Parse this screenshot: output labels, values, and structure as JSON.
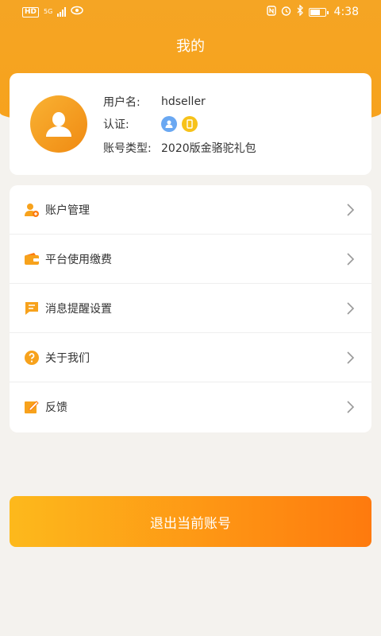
{
  "status_bar": {
    "left_chip": "HD",
    "network": "5G",
    "time": "4:38"
  },
  "page": {
    "title": "我的"
  },
  "profile": {
    "username_label": "用户名:",
    "username": "hdseller",
    "cert_label": "认证:",
    "account_type_label": "账号类型:",
    "account_type": "2020版金骆驼礼包"
  },
  "menu": {
    "items": [
      {
        "label": "账户管理",
        "icon": "user-manage-icon"
      },
      {
        "label": "平台使用缴费",
        "icon": "wallet-icon"
      },
      {
        "label": "消息提醒设置",
        "icon": "message-icon"
      },
      {
        "label": "关于我们",
        "icon": "question-icon"
      },
      {
        "label": "反馈",
        "icon": "feedback-edit-icon"
      }
    ]
  },
  "logout": {
    "label": "退出当前账号"
  },
  "colors": {
    "accent": "#F7A21C",
    "button_start": "#FDB91C",
    "button_end": "#FE7A0E"
  }
}
